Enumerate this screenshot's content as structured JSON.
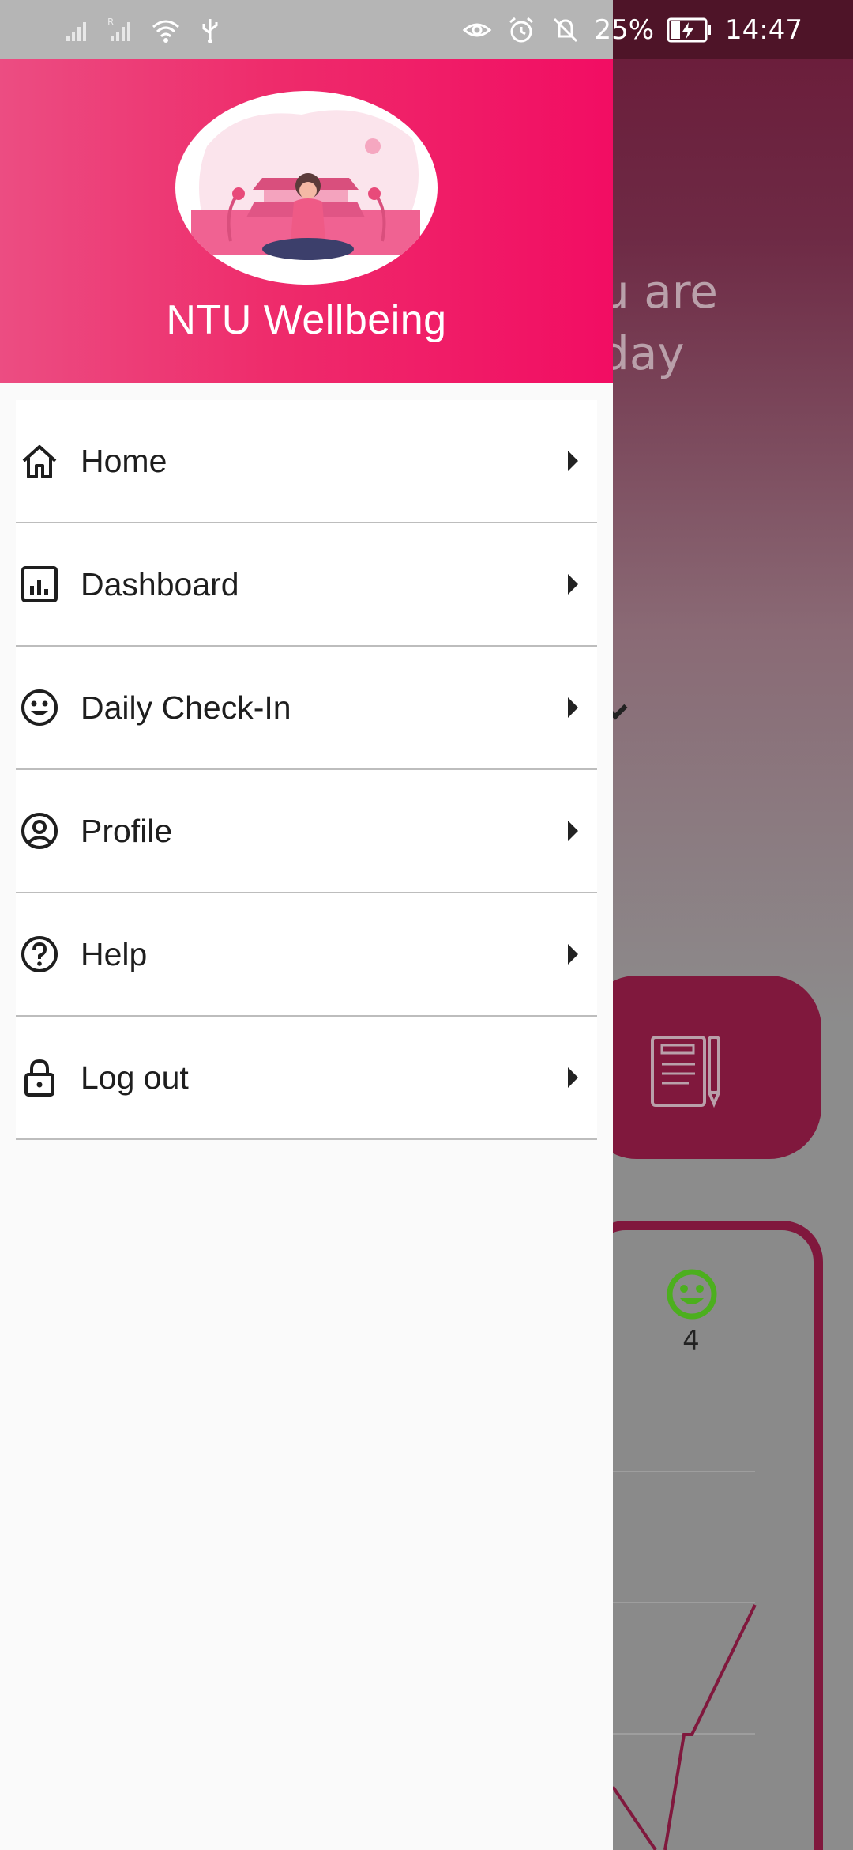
{
  "status_bar": {
    "battery_percent": "25%",
    "time": "14:47"
  },
  "drawer": {
    "app_title": "NTU Wellbeing",
    "menu_items": [
      {
        "label": "Home",
        "icon": "home-icon"
      },
      {
        "label": "Dashboard",
        "icon": "dashboard-icon"
      },
      {
        "label": "Daily Check-In",
        "icon": "smiley-icon"
      },
      {
        "label": "Profile",
        "icon": "profile-icon"
      },
      {
        "label": "Help",
        "icon": "help-icon"
      },
      {
        "label": "Log out",
        "icon": "lock-icon"
      }
    ]
  },
  "background": {
    "greeting_partial": "u are\n day",
    "mood_value": "4"
  },
  "colors": {
    "header_start": "#ec4d82",
    "header_end": "#f20d63",
    "accent_dark": "#80183d",
    "mood_green": "#4caf1e"
  }
}
